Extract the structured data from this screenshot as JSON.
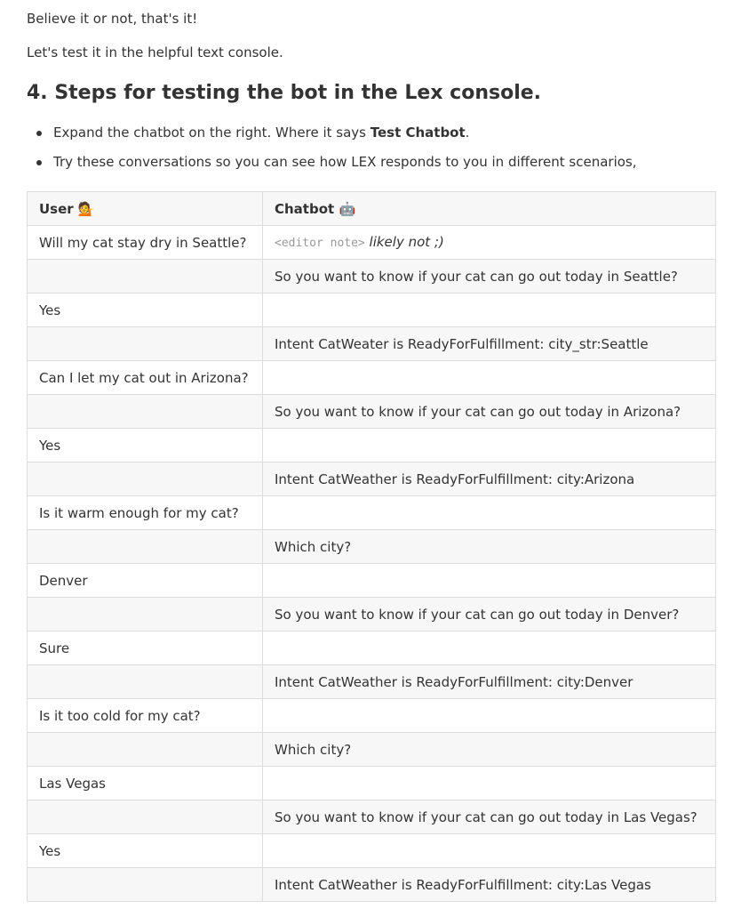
{
  "intro": {
    "line1": "Believe it or not, that's it!",
    "line2": "Let's test it in the helpful text console."
  },
  "section": {
    "heading": "4. Steps for testing the bot in the Lex console."
  },
  "bullets": [
    {
      "pre": "Expand the chatbot on the right. Where it says ",
      "bold": "Test Chatbot",
      "post": "."
    },
    {
      "text": "Try these conversations so you can see how LEX responds to you in different scenarios,"
    }
  ],
  "table": {
    "headers": {
      "user": "User",
      "user_emoji": "💁",
      "chatbot": "Chatbot",
      "chatbot_emoji": "🤖"
    },
    "editor_note": {
      "code": "<editor note>",
      "italic": "likely not ;)"
    },
    "rows": [
      {
        "user": "Will my cat stay dry in Seattle?",
        "bot": ""
      },
      {
        "user": "",
        "bot": "So you want to know if your cat can go out today in Seattle?"
      },
      {
        "user": "Yes",
        "bot": ""
      },
      {
        "user": "",
        "bot": "Intent CatWeater is ReadyForFulfillment: city_str:Seattle"
      },
      {
        "user": "Can I let my cat out in Arizona?",
        "bot": ""
      },
      {
        "user": "",
        "bot": "So you want to know if your cat can go out today in Arizona?"
      },
      {
        "user": "Yes",
        "bot": ""
      },
      {
        "user": "",
        "bot": "Intent CatWeather is ReadyForFulfillment: city:Arizona"
      },
      {
        "user": "Is it warm enough for my cat?",
        "bot": ""
      },
      {
        "user": "",
        "bot": "Which city?"
      },
      {
        "user": "Denver",
        "bot": ""
      },
      {
        "user": "",
        "bot": "So you want to know if your cat can go out today in Denver?"
      },
      {
        "user": "Sure",
        "bot": ""
      },
      {
        "user": "",
        "bot": "Intent CatWeather is ReadyForFulfillment: city:Denver"
      },
      {
        "user": "Is it too cold for my cat?",
        "bot": ""
      },
      {
        "user": "",
        "bot": "Which city?"
      },
      {
        "user": "Las Vegas",
        "bot": ""
      },
      {
        "user": "",
        "bot": "So you want to know if your cat can go out today in Las Vegas?"
      },
      {
        "user": "Yes",
        "bot": ""
      },
      {
        "user": "",
        "bot": "Intent CatWeather is ReadyForFulfillment: city:Las Vegas"
      }
    ]
  }
}
